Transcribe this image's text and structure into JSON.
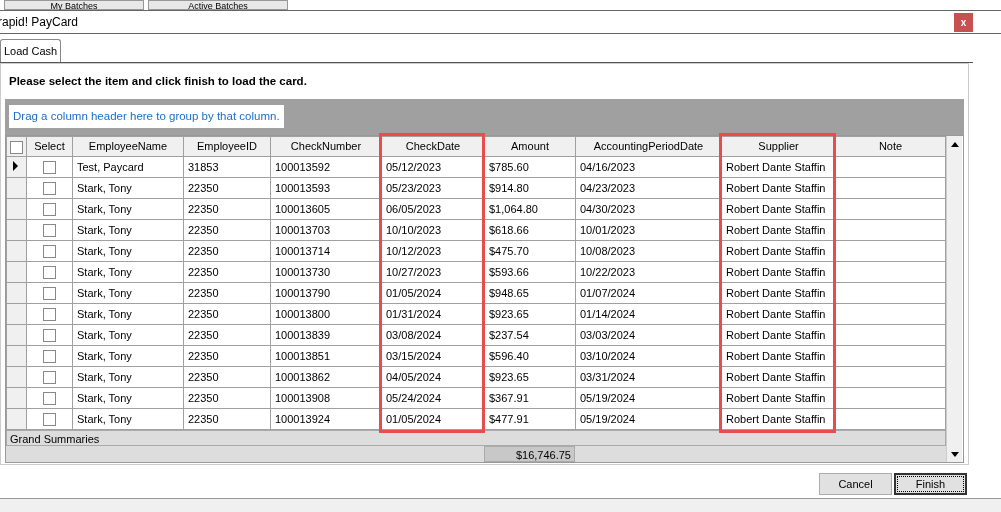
{
  "background_tabs": [
    "My Batches",
    "Active Batches"
  ],
  "window": {
    "title": "rapid! PayCard",
    "close": "x"
  },
  "tabs": [
    {
      "label": "Load Cash",
      "selected": true
    }
  ],
  "instruction": "Please select the item and click finish to load the card.",
  "group_panel": {
    "hint": "Drag a column header here to group by that column."
  },
  "table": {
    "select_all_checked": false,
    "select_header": "Select",
    "columns": [
      {
        "label": "EmployeeName",
        "highlighted": false
      },
      {
        "label": "EmployeeID",
        "highlighted": false
      },
      {
        "label": "CheckNumber",
        "highlighted": false
      },
      {
        "label": "CheckDate",
        "highlighted": true
      },
      {
        "label": "Amount",
        "highlighted": false
      },
      {
        "label": "AccountingPeriodDate",
        "highlighted": false
      },
      {
        "label": "Supplier",
        "highlighted": true
      },
      {
        "label": "Note",
        "highlighted": false
      }
    ],
    "rows": [
      {
        "current": true,
        "checked": false,
        "cells": [
          "Test, Paycard",
          "31853",
          "100013592",
          "05/12/2023",
          "$785.60",
          "04/16/2023",
          "Robert Dante Staffin",
          ""
        ]
      },
      {
        "current": false,
        "checked": false,
        "cells": [
          "Stark, Tony",
          "22350",
          "100013593",
          "05/23/2023",
          "$914.80",
          "04/23/2023",
          "Robert Dante Staffin",
          ""
        ]
      },
      {
        "current": false,
        "checked": false,
        "cells": [
          "Stark, Tony",
          "22350",
          "100013605",
          "06/05/2023",
          "$1,064.80",
          "04/30/2023",
          "Robert Dante Staffin",
          ""
        ]
      },
      {
        "current": false,
        "checked": false,
        "cells": [
          "Stark, Tony",
          "22350",
          "100013703",
          "10/10/2023",
          "$618.66",
          "10/01/2023",
          "Robert Dante Staffin",
          ""
        ]
      },
      {
        "current": false,
        "checked": false,
        "cells": [
          "Stark, Tony",
          "22350",
          "100013714",
          "10/12/2023",
          "$475.70",
          "10/08/2023",
          "Robert Dante Staffin",
          ""
        ]
      },
      {
        "current": false,
        "checked": false,
        "cells": [
          "Stark, Tony",
          "22350",
          "100013730",
          "10/27/2023",
          "$593.66",
          "10/22/2023",
          "Robert Dante Staffin",
          ""
        ]
      },
      {
        "current": false,
        "checked": false,
        "cells": [
          "Stark, Tony",
          "22350",
          "100013790",
          "01/05/2024",
          "$948.65",
          "01/07/2024",
          "Robert Dante Staffin",
          ""
        ]
      },
      {
        "current": false,
        "checked": false,
        "cells": [
          "Stark, Tony",
          "22350",
          "100013800",
          "01/31/2024",
          "$923.65",
          "01/14/2024",
          "Robert Dante Staffin",
          ""
        ]
      },
      {
        "current": false,
        "checked": false,
        "cells": [
          "Stark, Tony",
          "22350",
          "100013839",
          "03/08/2024",
          "$237.54",
          "03/03/2024",
          "Robert Dante Staffin",
          ""
        ]
      },
      {
        "current": false,
        "checked": false,
        "cells": [
          "Stark, Tony",
          "22350",
          "100013851",
          "03/15/2024",
          "$596.40",
          "03/10/2024",
          "Robert Dante Staffin",
          ""
        ]
      },
      {
        "current": false,
        "checked": false,
        "cells": [
          "Stark, Tony",
          "22350",
          "100013862",
          "04/05/2024",
          "$923.65",
          "03/31/2024",
          "Robert Dante Staffin",
          ""
        ]
      },
      {
        "current": false,
        "checked": false,
        "cells": [
          "Stark, Tony",
          "22350",
          "100013908",
          "05/24/2024",
          "$367.91",
          "05/19/2024",
          "Robert Dante Staffin",
          ""
        ]
      },
      {
        "current": false,
        "checked": false,
        "cells": [
          "Stark, Tony",
          "22350",
          "100013924",
          "01/05/2024",
          "$477.91",
          "05/19/2024",
          "Robert Dante Staffin",
          ""
        ]
      }
    ],
    "summary_label": "Grand Summaries",
    "amount_total": "$16,746.75"
  },
  "buttons": [
    {
      "label": "Cancel",
      "default": false
    },
    {
      "label": "Finish",
      "default": true
    }
  ]
}
